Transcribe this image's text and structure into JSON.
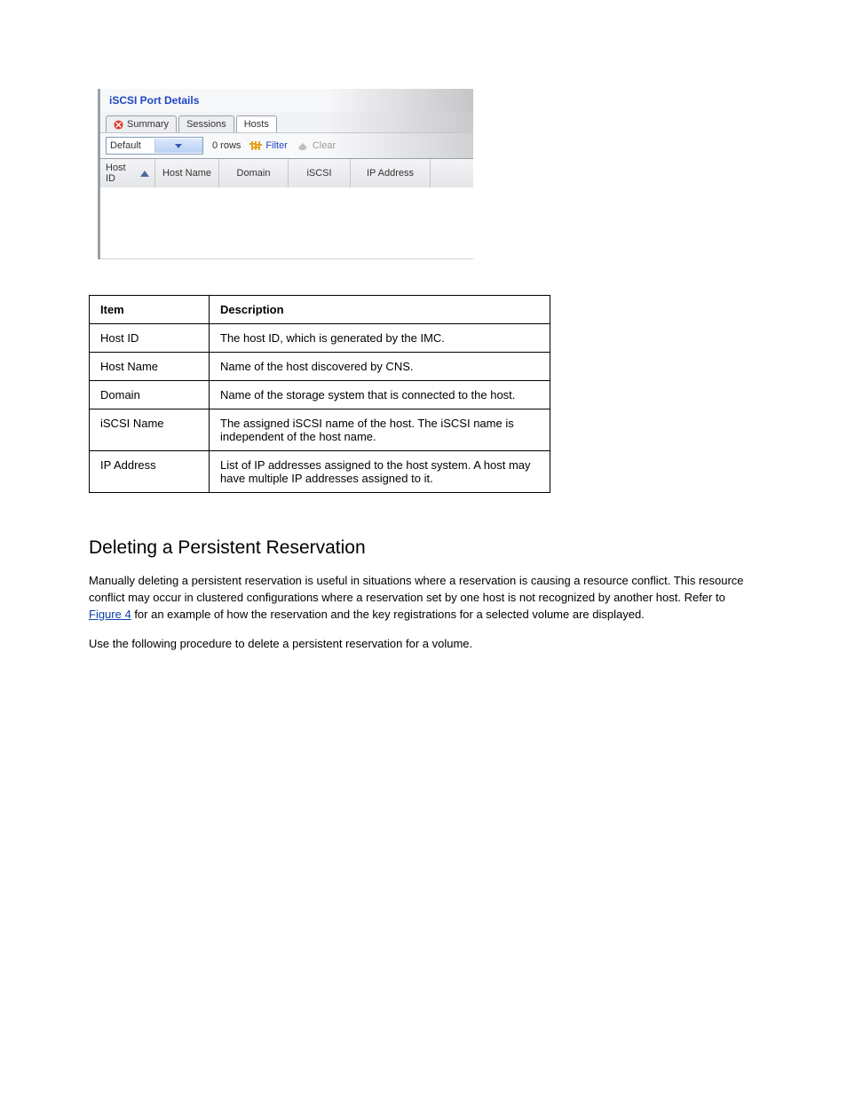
{
  "screenshot": {
    "panelTitle": "iSCSI Port Details",
    "tabs": {
      "summary": "Summary",
      "sessions": "Sessions",
      "hosts": "Hosts"
    },
    "filter": {
      "selectValue": "Default",
      "rowsText": "0 rows",
      "filterLabel": "Filter",
      "clearLabel": "Clear"
    },
    "columns": {
      "hostId": "Host ID",
      "hostName": "Host Name",
      "domain": "Domain",
      "iscsi": "iSCSI",
      "ipAddress": "IP Address"
    }
  },
  "descTable": {
    "head": {
      "item": "Item",
      "desc": "Description"
    },
    "rows": [
      {
        "item": "Host ID",
        "desc": "The host ID, which is generated by the IMC."
      },
      {
        "item": "Host Name",
        "desc": "Name of the host discovered by CNS."
      },
      {
        "item": "Domain",
        "desc": "Name of the storage system that is connected to the host."
      },
      {
        "item": "iSCSI Name",
        "desc": "The assigned iSCSI name of the host. The iSCSI name is independent of the host name."
      },
      {
        "item": "IP Address",
        "desc": "List of IP addresses assigned to the host system. A host may have multiple IP addresses assigned to it."
      }
    ]
  },
  "section": {
    "heading": "Deleting a Persistent Reservation",
    "p1a": "Manually deleting a persistent reservation is useful in situations where a reservation is causing a resource conflict. This resource conflict may occur in clustered configurations where a reservation set by one host is not recognized by another host. Refer to ",
    "p1link": "Figure 4",
    "p1b": " for an example of how the reservation and the key registrations for a selected volume are displayed.",
    "p2": "Use the following procedure to delete a persistent reservation for a volume."
  }
}
